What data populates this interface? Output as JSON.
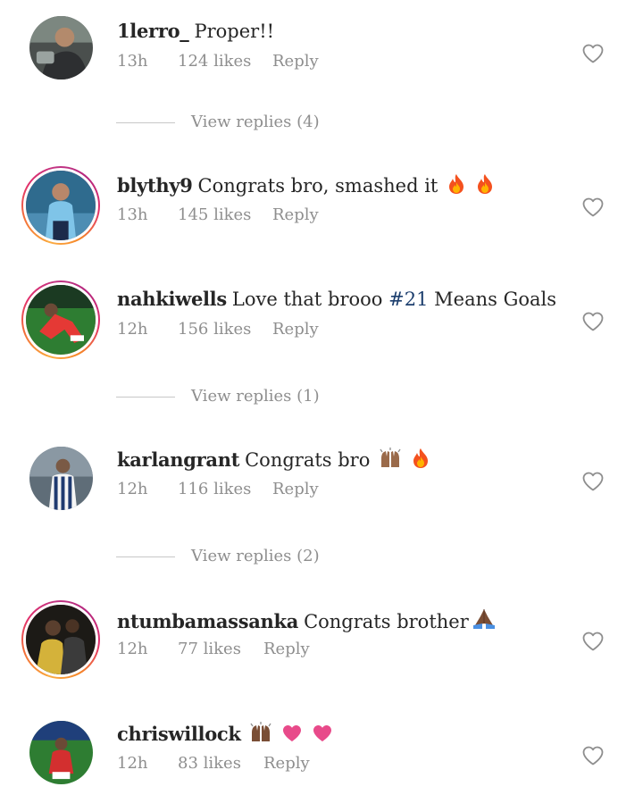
{
  "comments": [
    {
      "username": "1lerro_",
      "text": "Proper!!",
      "time": "13h",
      "likes": "124 likes",
      "reply": "Reply",
      "story_ring": false,
      "emojis": [],
      "view_replies": "View replies (4)"
    },
    {
      "username": "blythy9",
      "text": "Congrats bro, smashed it",
      "time": "13h",
      "likes": "145 likes",
      "reply": "Reply",
      "story_ring": true,
      "emojis": [
        "fire-emoji",
        "fire-emoji"
      ]
    },
    {
      "username": "nahkiwells",
      "text_before": "Love that brooo",
      "hashtag": "#21",
      "text_after": "Means Goals",
      "time": "12h",
      "likes": "156 likes",
      "reply": "Reply",
      "story_ring": true,
      "emojis": [],
      "view_replies": "View replies (1)"
    },
    {
      "username": "karlangrant",
      "text": "Congrats bro",
      "time": "12h",
      "likes": "116 likes",
      "reply": "Reply",
      "story_ring": false,
      "emojis": [
        "raising-hands-emoji",
        "fire-emoji"
      ],
      "view_replies": "View replies (2)"
    },
    {
      "username": "ntumbamassanka",
      "text": "Congrats brother",
      "time": "12h",
      "likes": "77 likes",
      "reply": "Reply",
      "story_ring": true,
      "emojis": [
        "folded-hands-emoji"
      ]
    },
    {
      "username": "chriswillock",
      "text": "",
      "time": "12h",
      "likes": "83 likes",
      "reply": "Reply",
      "story_ring": false,
      "emojis": [
        "raising-hands-emoji",
        "heart-emoji",
        "heart-emoji"
      ]
    }
  ],
  "colors": {
    "text": "#262626",
    "muted": "#8e8e8e",
    "hashtag": "#1d3f6e",
    "ring_start": "#f9a33b",
    "ring_end": "#c13584",
    "heart_outline": "#8e8e8e"
  },
  "icons": {
    "like": "heart-outline-icon"
  }
}
